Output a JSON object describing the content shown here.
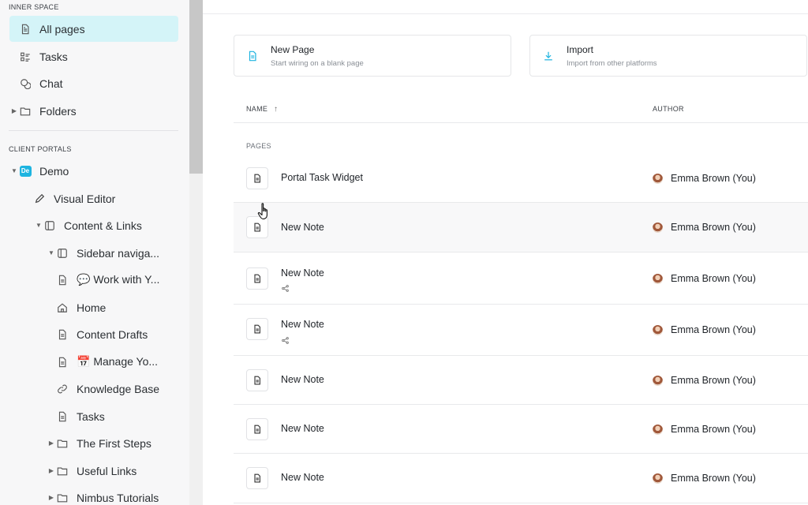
{
  "sidebar": {
    "sections": {
      "inner_space": "INNER SPACE",
      "client_portals": "CLIENT PORTALS"
    },
    "inner_items": [
      {
        "label": "All pages",
        "icon": "page-icon",
        "active": true
      },
      {
        "label": "Tasks",
        "icon": "tasks-icon"
      },
      {
        "label": "Chat",
        "icon": "chat-icon"
      },
      {
        "label": "Folders",
        "icon": "folder-icon"
      }
    ],
    "portal_items": [
      {
        "label": "Demo",
        "icon": "demo-badge",
        "badge": "De"
      },
      {
        "label": "Visual Editor",
        "icon": "pencil-icon"
      },
      {
        "label": "Content & Links",
        "icon": "sidebar-panel-icon"
      },
      {
        "label": "Sidebar naviga...",
        "icon": "sidebar-panel-icon"
      },
      {
        "label": "💬 Work with Y...",
        "icon": "page-icon"
      },
      {
        "label": "Home",
        "icon": "home-icon"
      },
      {
        "label": "Content Drafts",
        "icon": "page-icon"
      },
      {
        "label": "📅 Manage Yo...",
        "icon": "page-icon"
      },
      {
        "label": "Knowledge Base",
        "icon": "link-icon"
      },
      {
        "label": "Tasks",
        "icon": "page-icon"
      },
      {
        "label": "The First Steps",
        "icon": "folder-icon"
      },
      {
        "label": "Useful Links",
        "icon": "folder-icon"
      },
      {
        "label": "Nimbus Tutorials",
        "icon": "folder-icon"
      }
    ]
  },
  "main": {
    "cards": [
      {
        "title": "New Page",
        "subtitle": "Start wiring on a blank page",
        "icon": "page-icon",
        "color": "#1eb4e0"
      },
      {
        "title": "Import",
        "subtitle": "Import from other platforms",
        "icon": "download-icon",
        "color": "#1eb4e0"
      }
    ],
    "columns": {
      "name": "NAME",
      "author": "AUTHOR"
    },
    "group_label": "PAGES",
    "rows": [
      {
        "title": "Portal Task Widget",
        "author": "Emma Brown (You)",
        "shared": false
      },
      {
        "title": "New Note",
        "author": "Emma Brown (You)",
        "shared": false
      },
      {
        "title": "New Note",
        "author": "Emma Brown (You)",
        "shared": true
      },
      {
        "title": "New Note",
        "author": "Emma Brown (You)",
        "shared": true
      },
      {
        "title": "New Note",
        "author": "Emma Brown (You)",
        "shared": false
      },
      {
        "title": "New Note",
        "author": "Emma Brown (You)",
        "shared": false
      },
      {
        "title": "New Note",
        "author": "Emma Brown (You)",
        "shared": false
      }
    ]
  },
  "colors": {
    "accent": "#1eb4e0",
    "active_bg": "#d4f4f8"
  }
}
